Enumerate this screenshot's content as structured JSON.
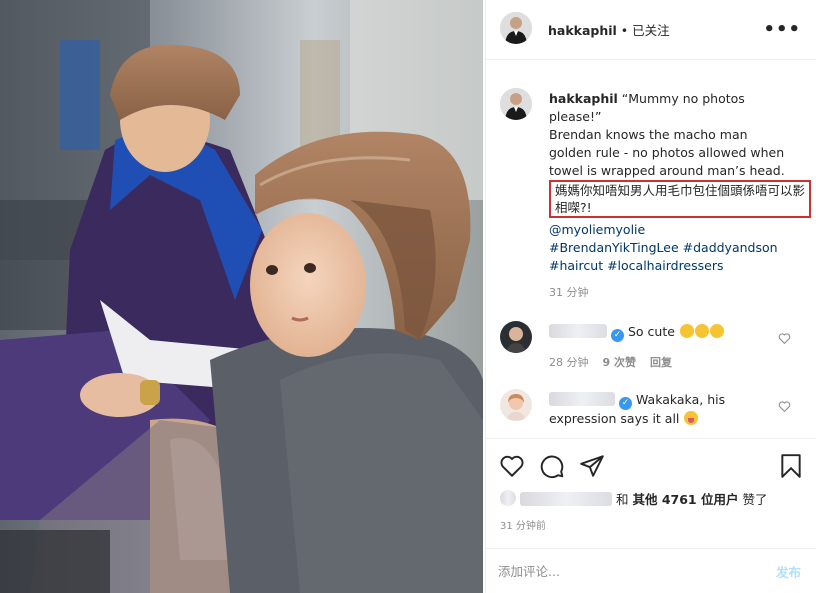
{
  "header": {
    "username": "hakkaphil",
    "separator": " • ",
    "follow_status": "已关注",
    "more_icon": "more-options-icon"
  },
  "caption": {
    "username": "hakkaphil",
    "line_quote": "“Mummy no photos please!”",
    "line_rule": "Brendan knows the macho man golden rule - no photos allowed when towel is wrapped around man’s head.",
    "line_chinese": "媽媽你知唔知男人用毛巾包住個頭係唔可以影相㗎?!",
    "mention": "@myoliemyolie",
    "hashtags_line1": "#BrendanYikTingLee #daddyandson",
    "hashtags_line2": "#haircut #localhairdressers",
    "time": "31 分钟"
  },
  "comments": [
    {
      "text": "So cute",
      "emoji_count": 3,
      "time": "28 分钟",
      "likes": "9 次赞",
      "reply": "回复"
    },
    {
      "text": "Wakakaka, his expression says it all",
      "emoji_count": 1
    }
  ],
  "actions": {
    "icons": [
      "heart-icon",
      "comment-icon",
      "share-icon",
      "bookmark-icon"
    ],
    "likes_connector": "和",
    "likes_others": "其他 4761 位用户",
    "likes_suffix": "赞了",
    "post_time": "31 分钟前"
  },
  "comment_box": {
    "placeholder": "添加评论...",
    "post_label": "发布"
  },
  "colors": {
    "highlight_border": "#d0302f",
    "link": "#00376b",
    "verified": "#3897f0",
    "post_disabled": "#b2dffc",
    "meta_gray": "#8e8e8e"
  }
}
